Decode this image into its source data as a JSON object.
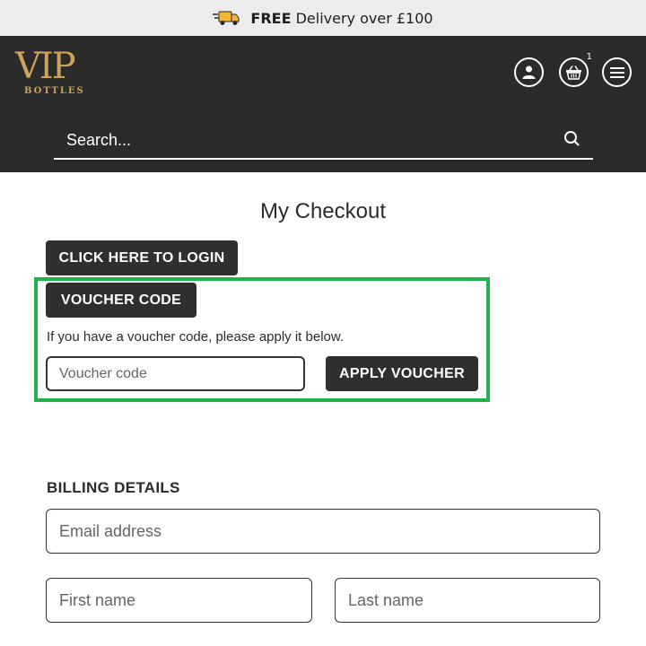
{
  "promo": {
    "bold": "FREE",
    "rest": " Delivery over £100",
    "icon": "delivery-van-icon"
  },
  "brand": {
    "logo_main": "VIP",
    "logo_sub": "BOTTLES",
    "gold": "#c9a45a"
  },
  "header": {
    "icons": [
      "account-icon",
      "basket-icon",
      "menu-icon"
    ],
    "cart_count": "1",
    "search_placeholder": "Search..."
  },
  "checkout": {
    "title": "My Checkout",
    "login_button": "CLICK HERE TO LOGIN",
    "voucher_button": "VOUCHER CODE",
    "voucher_info": "If you have a voucher code, please apply it below.",
    "voucher_placeholder": "Voucher code",
    "apply_button": "APPLY VOUCHER",
    "highlight_color": "#23b14d"
  },
  "billing": {
    "title": "BILLING DETAILS",
    "email_placeholder": "Email address",
    "first_name_placeholder": "First name",
    "last_name_placeholder": "Last name"
  }
}
